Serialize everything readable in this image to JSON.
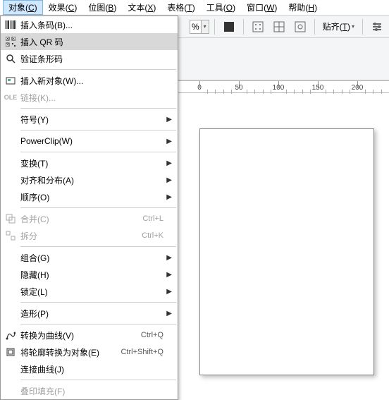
{
  "menubar": [
    {
      "label": "对象",
      "key": "C",
      "active": true
    },
    {
      "label": "效果",
      "key": "C"
    },
    {
      "label": "位图",
      "key": "B"
    },
    {
      "label": "文本",
      "key": "X"
    },
    {
      "label": "表格",
      "key": "T"
    },
    {
      "label": "工具",
      "key": "O"
    },
    {
      "label": "窗口",
      "key": "W"
    },
    {
      "label": "帮助",
      "key": "H"
    }
  ],
  "toolbar": {
    "pct": "%",
    "align_label": "贴齐",
    "align_key": "T"
  },
  "ruler": [
    "0",
    "50",
    "100",
    "150",
    "200"
  ],
  "menu": [
    {
      "type": "item",
      "icon": "barcode",
      "binds": {
        "label": "m.insert_barcode"
      }
    },
    {
      "type": "item",
      "icon": "qr",
      "hover": true,
      "binds": {
        "label": "m.insert_qr"
      }
    },
    {
      "type": "item",
      "icon": "search",
      "binds": {
        "label": "m.validate_barcode"
      }
    },
    {
      "type": "sep"
    },
    {
      "type": "item",
      "icon": "new-obj",
      "binds": {
        "label": "m.insert_new"
      }
    },
    {
      "type": "item",
      "icon": "ole",
      "disabled": true,
      "binds": {
        "label": "m.link"
      }
    },
    {
      "type": "sep"
    },
    {
      "type": "item",
      "submenu": true,
      "binds": {
        "label": "m.symbol"
      }
    },
    {
      "type": "sep"
    },
    {
      "type": "item",
      "submenu": true,
      "binds": {
        "label": "m.powerclip"
      }
    },
    {
      "type": "sep"
    },
    {
      "type": "item",
      "submenu": true,
      "binds": {
        "label": "m.transform"
      }
    },
    {
      "type": "item",
      "submenu": true,
      "binds": {
        "label": "m.align_dist"
      }
    },
    {
      "type": "item",
      "submenu": true,
      "binds": {
        "label": "m.order"
      }
    },
    {
      "type": "sep"
    },
    {
      "type": "item",
      "icon": "combine",
      "disabled": true,
      "binds": {
        "label": "m.combine",
        "shortcut": "m.combine_sc"
      }
    },
    {
      "type": "item",
      "icon": "break",
      "disabled": true,
      "binds": {
        "label": "m.break",
        "shortcut": "m.break_sc"
      }
    },
    {
      "type": "sep"
    },
    {
      "type": "item",
      "submenu": true,
      "binds": {
        "label": "m.group"
      }
    },
    {
      "type": "item",
      "submenu": true,
      "binds": {
        "label": "m.hide"
      }
    },
    {
      "type": "item",
      "submenu": true,
      "binds": {
        "label": "m.lock"
      }
    },
    {
      "type": "sep"
    },
    {
      "type": "item",
      "submenu": true,
      "binds": {
        "label": "m.shape"
      }
    },
    {
      "type": "sep"
    },
    {
      "type": "item",
      "icon": "curve",
      "binds": {
        "label": "m.to_curve",
        "shortcut": "m.to_curve_sc"
      }
    },
    {
      "type": "item",
      "icon": "outline",
      "binds": {
        "label": "m.outline_obj",
        "shortcut": "m.outline_obj_sc"
      }
    },
    {
      "type": "item",
      "binds": {
        "label": "m.join_curve"
      }
    },
    {
      "type": "sep"
    },
    {
      "type": "item",
      "disabled": true,
      "binds": {
        "label": "m.overprint"
      }
    }
  ],
  "m": {
    "insert_barcode": "插入条码(B)...",
    "insert_qr": "插入 QR 码",
    "validate_barcode": "验证条形码",
    "insert_new": "插入新对象(W)...",
    "link": "链接(K)...",
    "symbol": "符号(Y)",
    "powerclip": "PowerClip(W)",
    "transform": "变换(T)",
    "align_dist": "对齐和分布(A)",
    "order": "顺序(O)",
    "combine": "合并(C)",
    "combine_sc": "Ctrl+L",
    "break": "拆分",
    "break_sc": "Ctrl+K",
    "group": "组合(G)",
    "hide": "隐藏(H)",
    "lock": "锁定(L)",
    "shape": "造形(P)",
    "to_curve": "转换为曲线(V)",
    "to_curve_sc": "Ctrl+Q",
    "outline_obj": "将轮廓转换为对象(E)",
    "outline_obj_sc": "Ctrl+Shift+Q",
    "join_curve": "连接曲线(J)",
    "overprint": "叠印填充(F)"
  }
}
